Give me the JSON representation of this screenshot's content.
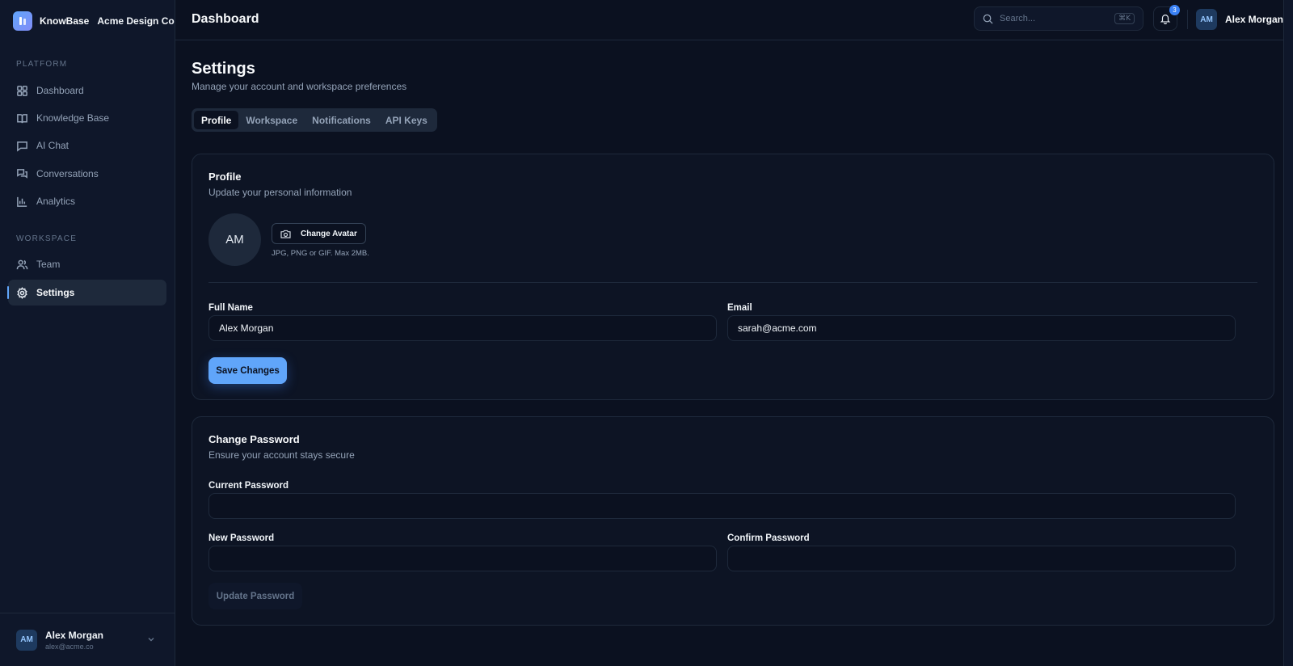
{
  "brand": {
    "name": "KnowBase",
    "workspace": "Acme Design Co"
  },
  "sidebar": {
    "sections": [
      {
        "label": "PLATFORM"
      },
      {
        "label": "WORKSPACE"
      }
    ],
    "items": [
      {
        "label": "Dashboard",
        "icon": "grid-icon"
      },
      {
        "label": "Knowledge Base",
        "icon": "book-icon"
      },
      {
        "label": "AI Chat",
        "icon": "chat-icon"
      },
      {
        "label": "Conversations",
        "icon": "conversations-icon"
      },
      {
        "label": "Analytics",
        "icon": "bar-chart-icon"
      },
      {
        "label": "Team",
        "icon": "users-icon"
      },
      {
        "label": "Settings",
        "icon": "gear-icon",
        "active": true
      }
    ],
    "footer": {
      "initials": "AM",
      "name": "Alex Morgan",
      "email": "alex@acme.co"
    }
  },
  "topbar": {
    "title": "Dashboard",
    "search_placeholder": "Search...",
    "search_shortcut": "⌘K",
    "notification_count": "3",
    "user_initials": "AM",
    "user_name": "Alex Morgan"
  },
  "page": {
    "title": "Settings",
    "subtitle": "Manage your account and workspace preferences",
    "tabs": [
      "Profile",
      "Workspace",
      "Notifications",
      "API Keys"
    ],
    "active_tab": "Profile"
  },
  "profile": {
    "title": "Profile",
    "subtitle": "Update your personal information",
    "avatar_initials": "AM",
    "change_avatar_label": "Change Avatar",
    "avatar_hint": "JPG, PNG or GIF. Max 2MB.",
    "full_name_label": "Full Name",
    "full_name_value": "Alex Morgan",
    "email_label": "Email",
    "email_value": "sarah@acme.com",
    "save_label": "Save Changes"
  },
  "password": {
    "title": "Change Password",
    "subtitle": "Ensure your account stays secure",
    "current_label": "Current Password",
    "new_label": "New Password",
    "confirm_label": "Confirm Password",
    "update_label": "Update Password"
  },
  "colors": {
    "accent": "#60a5fa",
    "background": "#0b1120",
    "sidebar": "#0f172a",
    "border": "#1e293b"
  }
}
